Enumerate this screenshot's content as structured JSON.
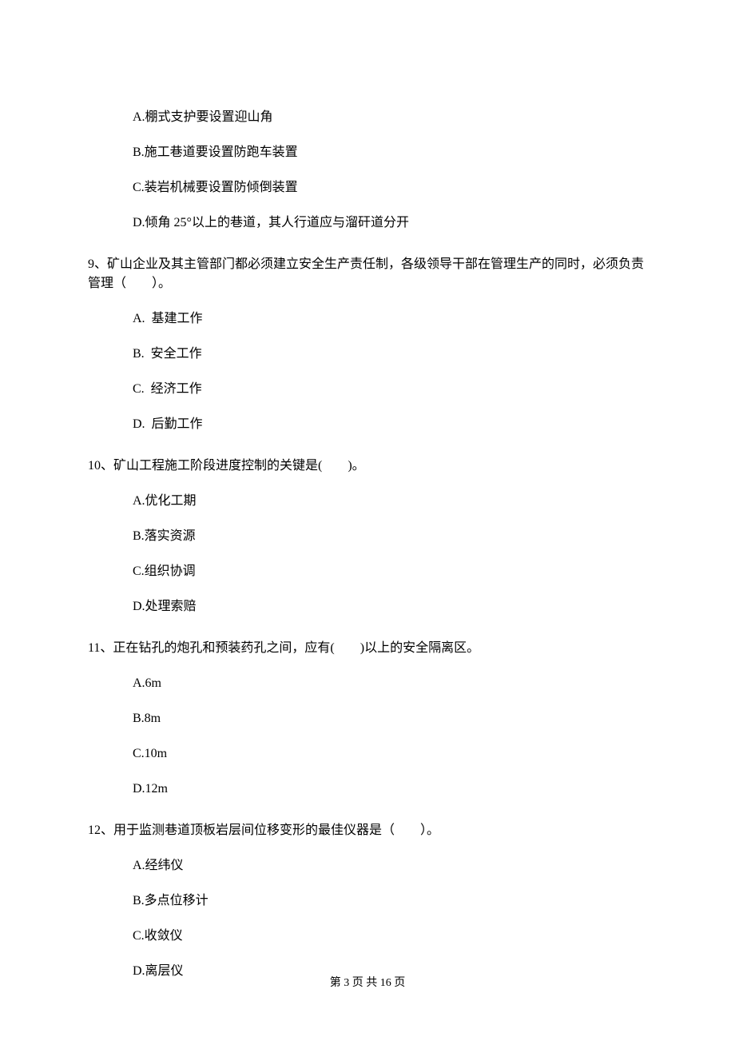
{
  "q8": {
    "A": "A.棚式支护要设置迎山角",
    "B": "B.施工巷道要设置防跑车装置",
    "C": "C.装岩机械要设置防倾倒装置",
    "D": "D.倾角 25°以上的巷道，其人行道应与溜矸道分开"
  },
  "q9": {
    "stem": "9、矿山企业及其主管部门都必须建立安全生产责任制，各级领导干部在管理生产的同时，必须负责管理（　　）。",
    "A": "A.  基建工作",
    "B": "B.  安全工作",
    "C": "C.  经济工作",
    "D": "D.  后勤工作"
  },
  "q10": {
    "stem": "10、矿山工程施工阶段进度控制的关键是(　　)。",
    "A": "A.优化工期",
    "B": "B.落实资源",
    "C": "C.组织协调",
    "D": "D.处理索赔"
  },
  "q11": {
    "stem": "11、正在钻孔的炮孔和预装药孔之间，应有(　　)以上的安全隔离区。",
    "A": "A.6m",
    "B": "B.8m",
    "C": "C.10m",
    "D": "D.12m"
  },
  "q12": {
    "stem": "12、用于监测巷道顶板岩层间位移变形的最佳仪器是（　　）。",
    "A": "A.经纬仪",
    "B": "B.多点位移计",
    "C": "C.收敛仪",
    "D": "D.离层仪"
  },
  "footer": "第 3 页 共 16 页"
}
